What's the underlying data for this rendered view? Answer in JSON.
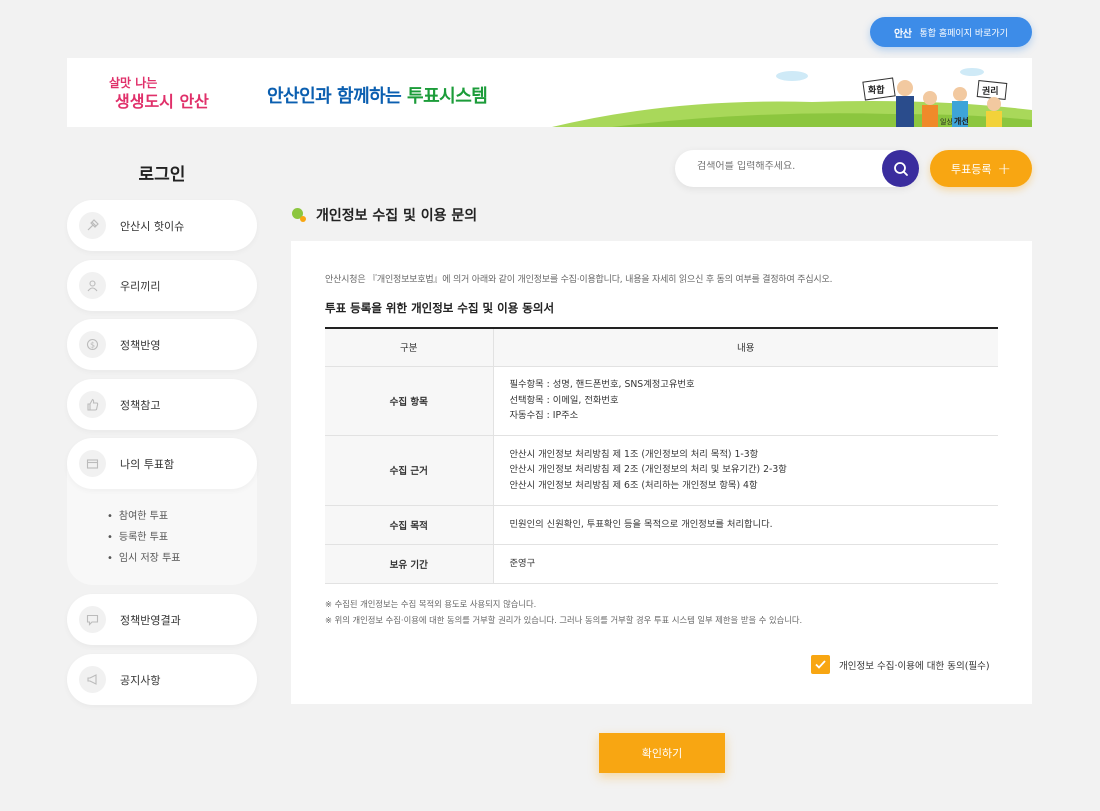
{
  "header": {
    "portal_logo": "안산",
    "portal_button_label": "통합 홈페이지 바로가기",
    "city_logo_top": "살맛 나는",
    "city_logo_bottom": "생생도시 안산",
    "banner_title_prefix": "안산인과 함께하는 ",
    "banner_title_highlight": "투표시스템",
    "banner_signs": [
      "화합",
      "권리",
      "일상",
      "개선"
    ]
  },
  "search": {
    "placeholder": "검색어를 입력해주세요."
  },
  "register_button": {
    "label": "투표등록",
    "icon": "plus-icon"
  },
  "sidebar": {
    "login_label": "로그인",
    "items": [
      {
        "label": "안산시 핫이슈",
        "icon": "hammer-icon"
      },
      {
        "label": "우리끼리",
        "icon": "person-icon"
      },
      {
        "label": "정책반영",
        "icon": "dollar-icon"
      },
      {
        "label": "정책참고",
        "icon": "thumbs-up-icon"
      },
      {
        "label": "나의 투표함",
        "icon": "box-icon",
        "sub_items": [
          "참여한 투표",
          "등록한 투표",
          "임시 저장 투표"
        ]
      },
      {
        "label": "정책반영결과",
        "icon": "chat-icon"
      },
      {
        "label": "공지사항",
        "icon": "megaphone-icon"
      }
    ]
  },
  "section": {
    "title": "개인정보 수집 및 이용 문의"
  },
  "content": {
    "intro": "안산시청은 『개인정보보호법』에 의거 아래와 같이 개인정보를 수집·이용합니다, 내용을 자세히 읽으신 후 동의 여부를 결정하여 주십시오.",
    "agreement_title": "투표 등록을 위한 개인정보 수집 및 이용 동의서",
    "table": {
      "headers": [
        "구분",
        "내용"
      ],
      "rows": [
        {
          "key": "수집 항목",
          "lines": [
            "필수항목 : 성명, 핸드폰번호, SNS계정고유번호",
            "선택항목 : 이메일, 전화번호",
            "자동수집 : IP주소"
          ]
        },
        {
          "key": "수집 근거",
          "lines": [
            "안산시 개인정보 처리방침 제 1조 (개인정보의 처리 목적) 1-3항",
            "안산시 개인정보 처리방침 제 2조 (개인정보의 처리 및 보유기간) 2-3항",
            "안산시 개인정보 처리방침 제 6조 (처리하는 개인정보 항목) 4항"
          ]
        },
        {
          "key": "수집 목적",
          "lines": [
            "민원인의 신원확인, 투표확인 등을 목적으로 개인정보를 처리합니다."
          ]
        },
        {
          "key": "보유 기간",
          "lines": [
            "준영구"
          ]
        }
      ]
    },
    "notes": [
      "※ 수집된 개인정보는 수집 목적외 용도로 사용되지 않습니다.",
      "※ 위의 개인정보 수집·이용에 대한 동의를 거부할 권리가 있습니다. 그러나 동의를 거부할 경우 투표 시스템 일부 제한을 받을 수 있습니다."
    ],
    "consent_label": "개인정보 수집·이용에 대한 동의(필수)",
    "consent_checked": true
  },
  "confirm_button": {
    "label": "확인하기"
  },
  "colors": {
    "accent": "#f8a612",
    "primary": "#3a2d9e",
    "portal": "#3d8ce8",
    "green": "#8cc63f"
  }
}
